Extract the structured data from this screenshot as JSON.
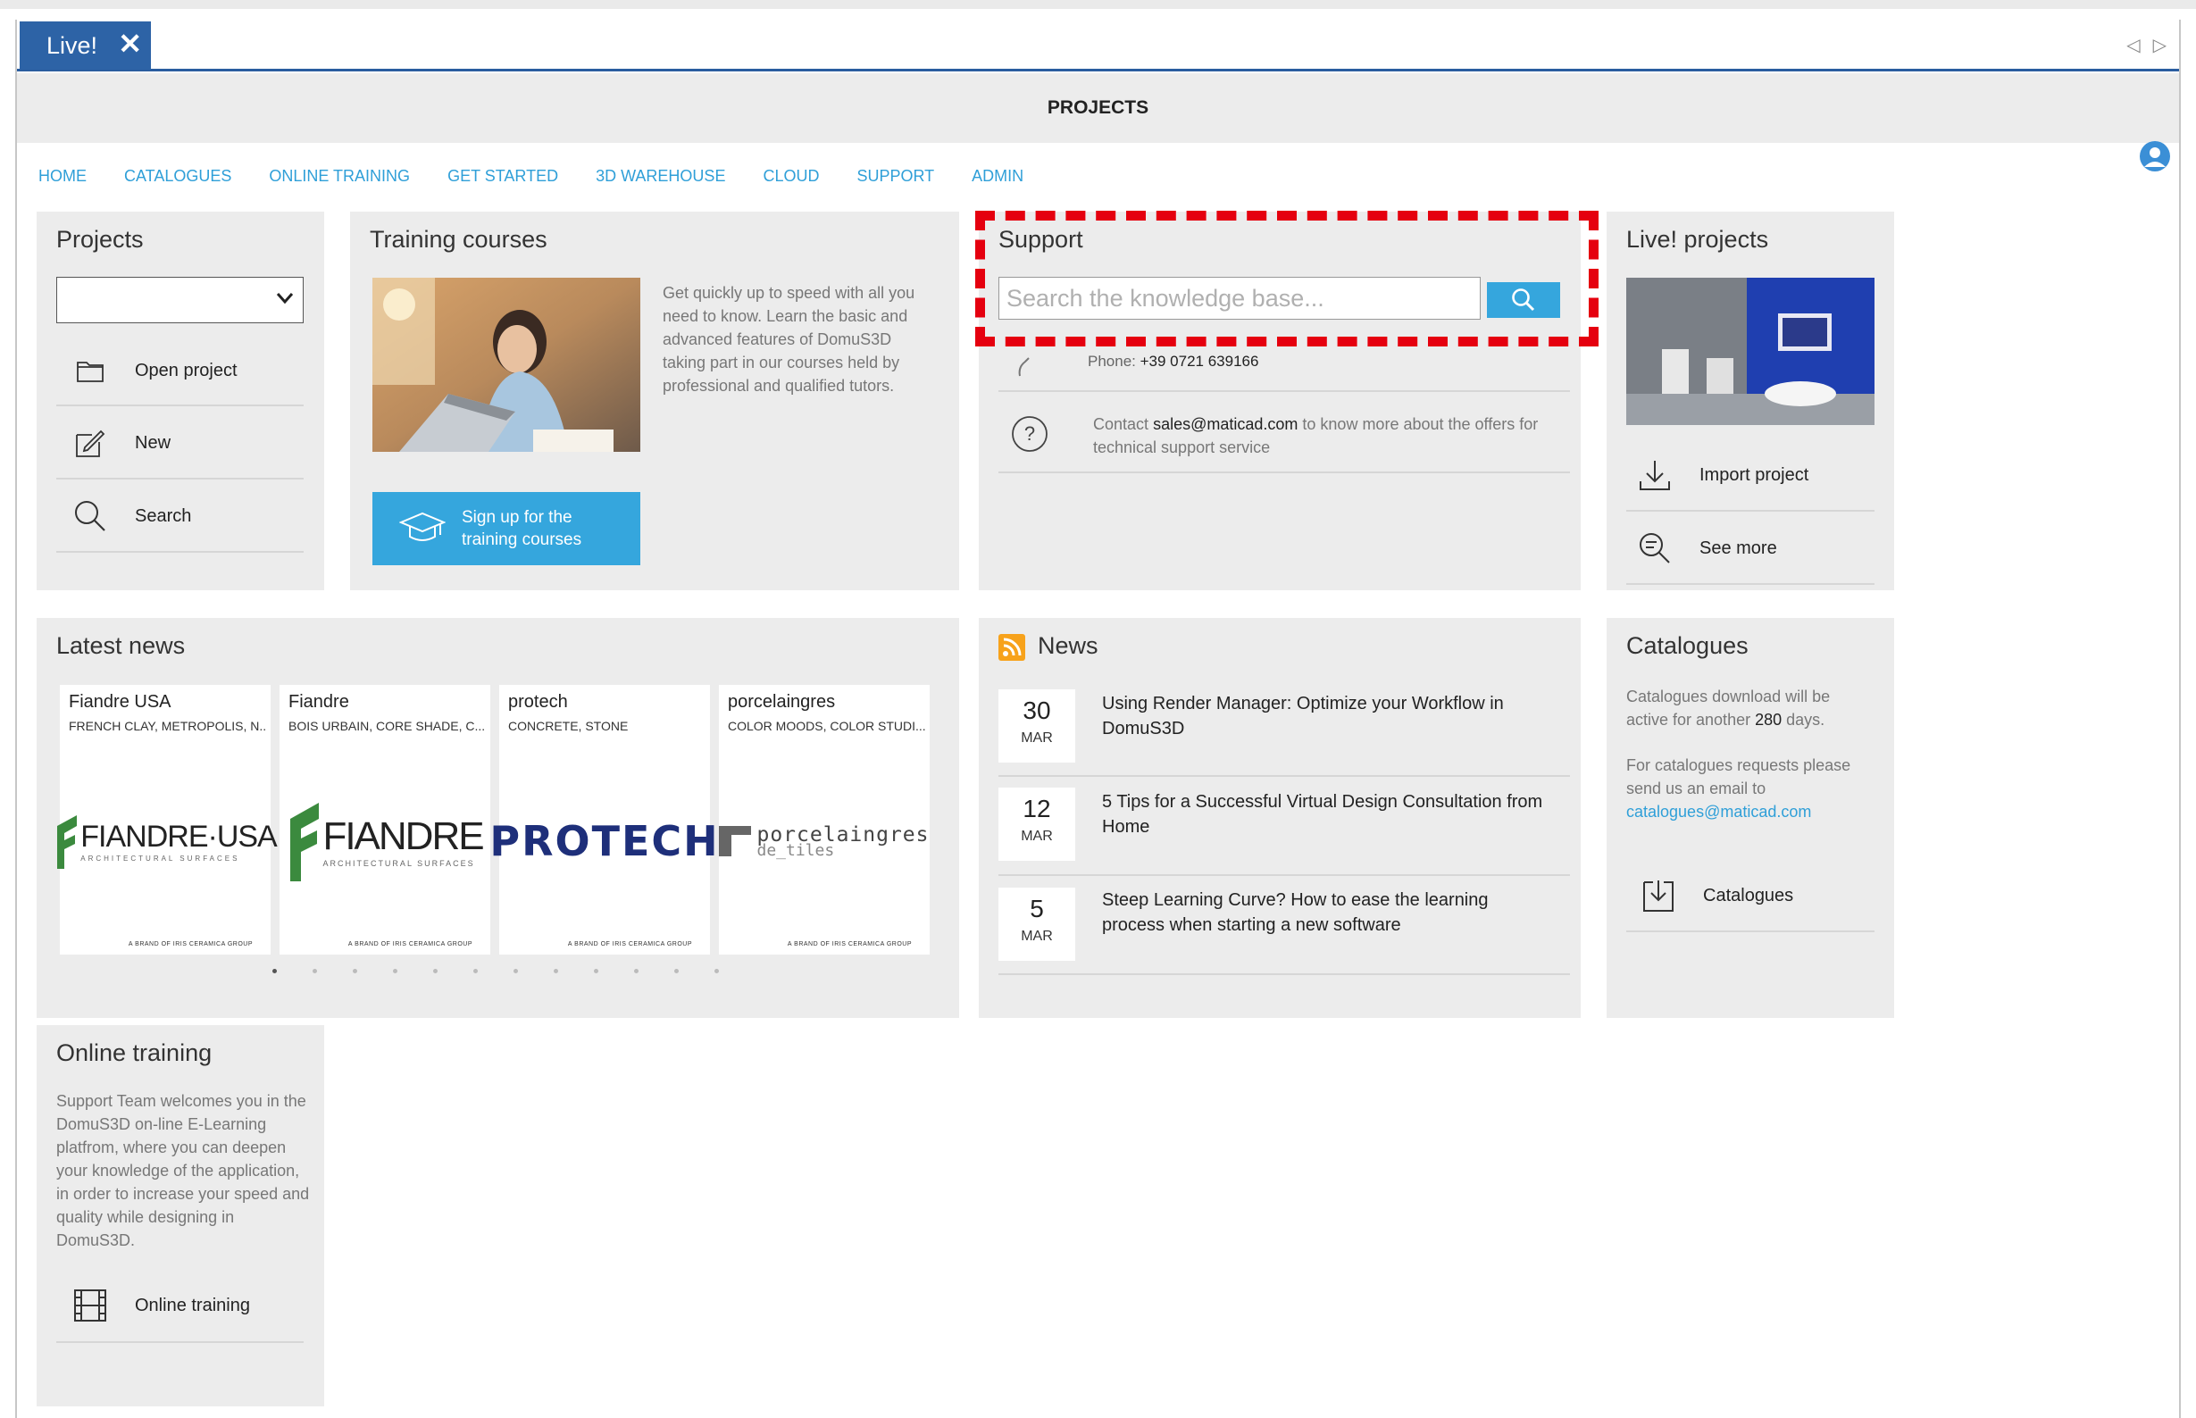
{
  "tab": {
    "label": "Live!",
    "close": "✕"
  },
  "window": {
    "title": "PROJECTS"
  },
  "nav": [
    "HOME",
    "CATALOGUES",
    "ONLINE TRAINING",
    "GET STARTED",
    "3D WAREHOUSE",
    "CLOUD",
    "SUPPORT",
    "ADMIN"
  ],
  "projects": {
    "title": "Projects",
    "select_value": "",
    "items": [
      {
        "label": "Open project",
        "icon": "folder-icon"
      },
      {
        "label": "New",
        "icon": "edit-icon"
      },
      {
        "label": "Search",
        "icon": "search-icon"
      }
    ]
  },
  "training": {
    "title": "Training courses",
    "description": "Get quickly up to speed with all you need to know. Learn the basic and advanced features of DomuS3D taking part in our courses held by professional and qualified tutors.",
    "button_line1": "Sign up for the",
    "button_line2": "training courses"
  },
  "support": {
    "title": "Support",
    "search_placeholder": "Search the knowledge base...",
    "phone_label": "Phone:",
    "phone": "+39 0721 639166",
    "contact_pre": "Contact",
    "contact_email": "sales@maticad.com",
    "contact_post": "to know more about the offers for technical support service"
  },
  "live_projects": {
    "title": "Live! projects",
    "items": [
      {
        "label": "Import project",
        "icon": "download-icon"
      },
      {
        "label": "See more",
        "icon": "zoom-icon"
      }
    ]
  },
  "latest_news": {
    "title": "Latest news",
    "cards": [
      {
        "name": "Fiandre USA",
        "tags": "FRENCH CLAY, METROPOLIS, N...",
        "logo": "FIANDRE·USA",
        "logo_sub": "ARCHITECTURAL SURFACES"
      },
      {
        "name": "Fiandre",
        "tags": "BOIS URBAIN, CORE SHADE, C...",
        "logo": "FIANDRE",
        "logo_sub": "ARCHITECTURAL SURFACES"
      },
      {
        "name": "protech",
        "tags": "CONCRETE, STONE",
        "logo": "PROTECH",
        "logo_sub": ""
      },
      {
        "name": "porcelaingres",
        "tags": "COLOR MOODS, COLOR STUDI...",
        "logo": "porcelaingres",
        "logo_sub": "de_tiles"
      }
    ],
    "brand_text": "A BRAND OF  IRIS CERAMICA GROUP",
    "dot_count": 12,
    "active_dot": 0
  },
  "news": {
    "title": "News",
    "items": [
      {
        "day": "30",
        "month": "MAR",
        "text": "Using Render Manager: Optimize your Workflow in DomuS3D"
      },
      {
        "day": "12",
        "month": "MAR",
        "text": "5 Tips for a Successful Virtual Design Consultation from Home"
      },
      {
        "day": "5",
        "month": "MAR",
        "text": "Steep Learning Curve? How to ease the learning process when starting a new software"
      }
    ]
  },
  "catalogues": {
    "title": "Catalogues",
    "text_pre": "Catalogues download will be active for another",
    "days": "280",
    "text_post": "days.",
    "request_text": "For catalogues requests please send us an email to",
    "email": "catalogues@maticad.com",
    "button": "Catalogues"
  },
  "online_training": {
    "title": "Online training",
    "description": "Support Team welcomes you in the DomuS3D on-line E-Learning platfrom, where you can deepen your knowledge of the application, in order to increase your speed and quality while designing in DomuS3D.",
    "button": "Online training"
  },
  "colors": {
    "accent": "#35a6dd",
    "tab": "#2d63a6",
    "highlight": "#e5000f",
    "rss": "#f7a21b"
  }
}
